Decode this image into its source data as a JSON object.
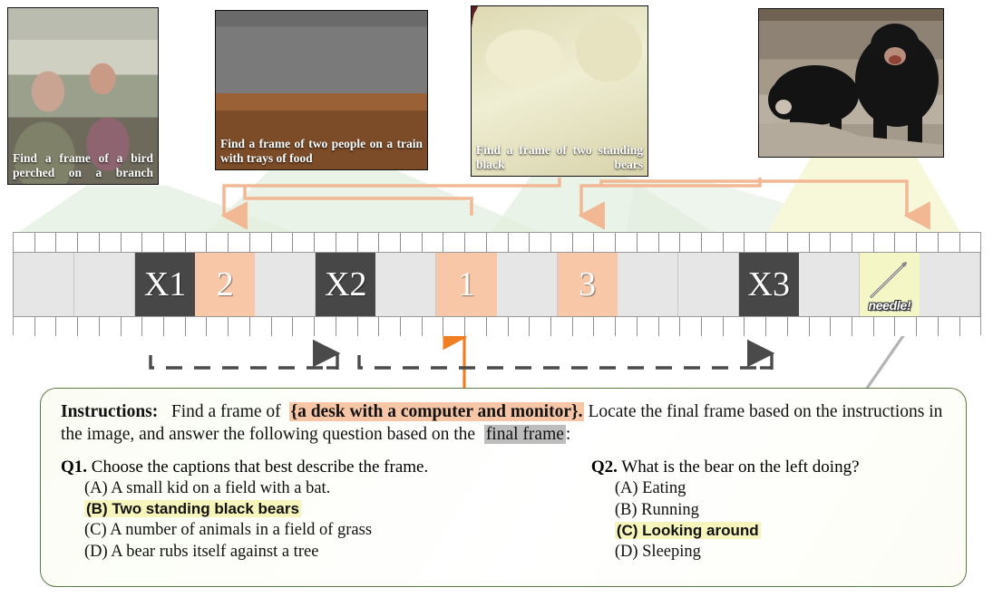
{
  "query_cards": [
    {
      "id": "card-bird",
      "caption": "Find a frame of a bird perched on a branch",
      "photo": "two-people-on-train-with-food-trays"
    },
    {
      "id": "card-train",
      "caption": "Find a frame of two people on a train with trays of food",
      "photo": "desk-with-computer-and-monitor"
    },
    {
      "id": "card-bears",
      "caption": "Find a frame of two standing black bears",
      "photo": "bird-perched-on-a-branch"
    },
    {
      "id": "card-answer",
      "caption": "",
      "photo": "two-standing-black-bears"
    }
  ],
  "filmstrip": {
    "frames": [
      {
        "label": "",
        "kind": "gray"
      },
      {
        "label": "",
        "kind": "gray"
      },
      {
        "label": "X1",
        "kind": "dark"
      },
      {
        "label": "2",
        "kind": "orange"
      },
      {
        "label": "",
        "kind": "gray"
      },
      {
        "label": "X2",
        "kind": "dark"
      },
      {
        "label": "",
        "kind": "gray"
      },
      {
        "label": "1",
        "kind": "orange"
      },
      {
        "label": "",
        "kind": "gray"
      },
      {
        "label": "3",
        "kind": "orange"
      },
      {
        "label": "",
        "kind": "gray"
      },
      {
        "label": "",
        "kind": "gray"
      },
      {
        "label": "X3",
        "kind": "dark"
      },
      {
        "label": "",
        "kind": "gray"
      },
      {
        "label": "needle!",
        "kind": "needle"
      },
      {
        "label": "",
        "kind": "gray"
      }
    ],
    "needle_label": "needle!"
  },
  "instructions": {
    "label": "Instructions:",
    "lead": "Find a frame of",
    "target": "{a desk with a computer and monitor}.",
    "mid": "Locate the final frame based on the instructions in the image, and answer the following question based on the",
    "final_frame": "final frame",
    "colon": ":"
  },
  "q1": {
    "num": "Q1.",
    "text": "Choose the captions that best describe the frame.",
    "options": [
      {
        "key": "(A)",
        "text": "A small kid on a field with a bat.",
        "selected": false
      },
      {
        "key": "(B)",
        "text": "Two standing black bears",
        "selected": true
      },
      {
        "key": "(C)",
        "text": "A number of animals in a field of grass",
        "selected": false
      },
      {
        "key": "(D)",
        "text": "A bear rubs itself against a tree",
        "selected": false
      }
    ]
  },
  "q2": {
    "num": "Q2.",
    "text": "What is the bear on the left doing?",
    "options": [
      {
        "key": "(A)",
        "text": "Eating",
        "selected": false
      },
      {
        "key": "(B)",
        "text": "Running",
        "selected": false
      },
      {
        "key": "(C)",
        "text": "Looking around",
        "selected": true
      },
      {
        "key": "(D)",
        "text": "Sleeping",
        "selected": false
      }
    ]
  },
  "colors": {
    "frame_orange": "#f7c7a8",
    "frame_dark": "#474747",
    "frame_gray": "#e6e6e6",
    "needle_yellow": "#f4f6c6",
    "connector_orange": "#f2b894",
    "arrow_orange": "#ef7f22",
    "panel_border": "#5d7a44",
    "highlight_yellow": "#f6f5bc",
    "highlight_gray": "#bdbdbd"
  }
}
